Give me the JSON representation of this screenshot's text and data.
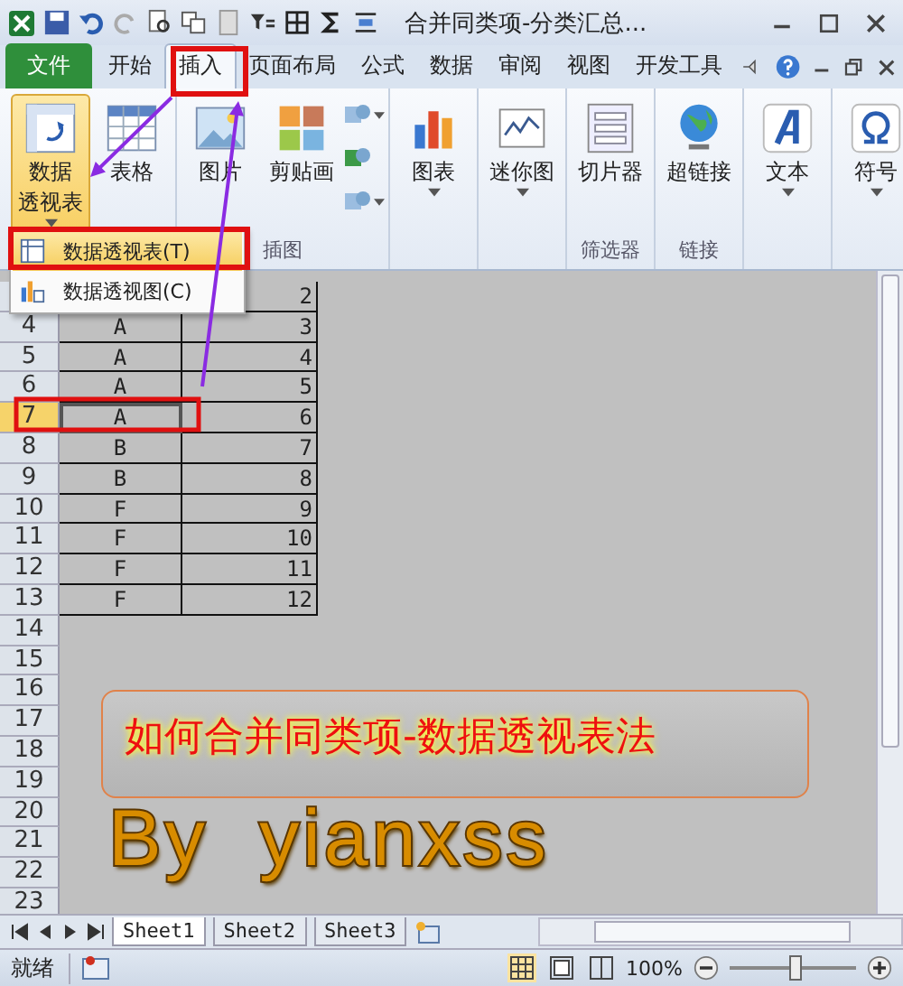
{
  "window": {
    "title": "合并同类项-分类汇总..."
  },
  "ribbon_tabs": [
    {
      "label": "文件",
      "kind": "file",
      "selected": false
    },
    {
      "label": "开始",
      "kind": "tab",
      "selected": false
    },
    {
      "label": "插入",
      "kind": "tab",
      "selected": true
    },
    {
      "label": "页面布局",
      "kind": "tab",
      "selected": false
    },
    {
      "label": "公式",
      "kind": "tab",
      "selected": false
    },
    {
      "label": "数据",
      "kind": "tab",
      "selected": false
    },
    {
      "label": "审阅",
      "kind": "tab",
      "selected": false
    },
    {
      "label": "视图",
      "kind": "tab",
      "selected": false
    },
    {
      "label": "开发工具",
      "kind": "tab",
      "selected": false
    }
  ],
  "ribbon_groups": [
    {
      "buttons": [
        {
          "label_lines": [
            "数据",
            "透视表"
          ],
          "dropdown": true,
          "pressed": true
        },
        {
          "label": "表格",
          "dropdown": false,
          "pressed": false
        }
      ]
    },
    {
      "label": "插图",
      "buttons": [
        {
          "label": "图片",
          "dropdown": false,
          "pressed": false
        },
        {
          "label": "剪贴画",
          "dropdown": false,
          "pressed": false
        }
      ],
      "small_buttons": [
        {
          "dropdown": true
        },
        {
          "dropdown": false
        },
        {
          "dropdown": true
        }
      ]
    },
    {
      "buttons": [
        {
          "label": "图表",
          "dropdown": true,
          "pressed": false
        }
      ]
    },
    {
      "buttons": [
        {
          "label": "迷你图",
          "dropdown": true,
          "pressed": false
        }
      ]
    },
    {
      "label": "筛选器",
      "buttons": [
        {
          "label": "切片器",
          "dropdown": false,
          "pressed": false
        }
      ]
    },
    {
      "label": "链接",
      "buttons": [
        {
          "label": "超链接",
          "dropdown": false,
          "pressed": false
        }
      ]
    },
    {
      "buttons": [
        {
          "label": "文本",
          "dropdown": true,
          "pressed": false
        }
      ]
    },
    {
      "buttons": [
        {
          "label": "符号",
          "dropdown": true,
          "pressed": false
        }
      ]
    }
  ],
  "dropdown_menu": [
    {
      "label": "数据透视表(T)",
      "selected": true
    },
    {
      "label": "数据透视图(C)",
      "selected": false
    }
  ],
  "sheet_rows": [
    {
      "c": "2",
      "selected": false
    },
    {
      "number": "4",
      "b": "A",
      "c": "3",
      "selected": false
    },
    {
      "number": "5",
      "b": "A",
      "c": "4",
      "selected": false
    },
    {
      "number": "6",
      "b": "A",
      "c": "5",
      "selected": false
    },
    {
      "number": "7",
      "b": "A",
      "c": "6",
      "selected": true
    },
    {
      "number": "8",
      "b": "B",
      "c": "7",
      "selected": false
    },
    {
      "number": "9",
      "b": "B",
      "c": "8",
      "selected": false
    },
    {
      "number": "10",
      "b": "F",
      "c": "9",
      "selected": false
    },
    {
      "number": "11",
      "b": "F",
      "c": "10",
      "selected": false
    },
    {
      "number": "12",
      "b": "F",
      "c": "11",
      "selected": false
    },
    {
      "number": "13",
      "b": "F",
      "c": "12",
      "selected": false
    },
    {
      "number": "14",
      "selected": false
    },
    {
      "number": "15",
      "selected": false
    },
    {
      "number": "16",
      "selected": false
    },
    {
      "number": "17",
      "selected": false
    },
    {
      "number": "18",
      "selected": false
    },
    {
      "number": "19",
      "selected": false
    },
    {
      "number": "20",
      "selected": false
    },
    {
      "number": "21",
      "selected": false
    },
    {
      "number": "22",
      "selected": false
    },
    {
      "number": "23",
      "selected": false
    }
  ],
  "overlay_title": "如何合并同类项-数据透视表法",
  "overlay_byline": "By yianxss",
  "sheet_tabs": [
    {
      "label": "Sheet1",
      "selected": true
    },
    {
      "label": "Sheet2",
      "selected": false
    },
    {
      "label": "Sheet3",
      "selected": false
    }
  ],
  "status_bar": {
    "mode": "就绪",
    "zoom": "100%",
    "zoom_slider": {
      "level": 0.5
    }
  }
}
